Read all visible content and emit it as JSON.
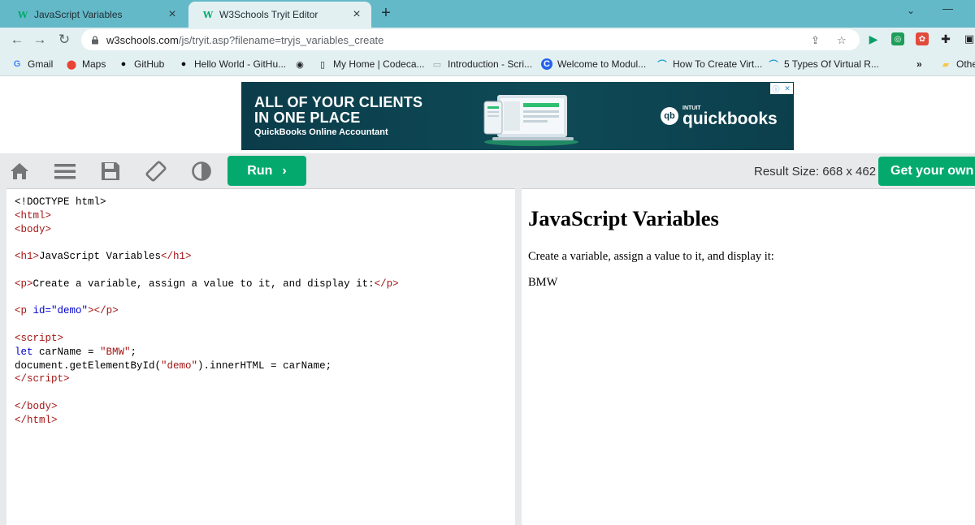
{
  "browser": {
    "tabs": [
      {
        "title": "JavaScript Variables",
        "active": false
      },
      {
        "title": "W3Schools Tryit Editor",
        "active": true
      }
    ],
    "url_host": "w3schools.com",
    "url_path": "/js/tryit.asp?filename=tryjs_variables_create",
    "bookmarks": [
      {
        "label": "Gmail",
        "icon": "google-icon"
      },
      {
        "label": "Maps",
        "icon": "maps-pin-icon"
      },
      {
        "label": "GitHub",
        "icon": "github-icon"
      },
      {
        "label": "Hello World - GitHu...",
        "icon": "github-icon"
      },
      {
        "label": "",
        "icon": "globe-icon"
      },
      {
        "label": "My Home | Codeca...",
        "icon": "codecademy-icon"
      },
      {
        "label": "Introduction - Scri...",
        "icon": "page-icon"
      },
      {
        "label": "Welcome to Modul...",
        "icon": "c-icon"
      },
      {
        "label": "How To Create Virt...",
        "icon": "bird-icon"
      },
      {
        "label": "5 Types Of Virtual R...",
        "icon": "bird-icon"
      }
    ],
    "bookmarks_overflow": "»",
    "other_bookmarks": "Othe"
  },
  "ad": {
    "line1": "ALL OF YOUR CLIENTS",
    "line2": "IN ONE PLACE",
    "sub": "QuickBooks Online Accountant",
    "brand_small": "INTUIT",
    "brand": "quickbooks",
    "brand_logo": "qb"
  },
  "tryit": {
    "run_label": "Run",
    "run_chevron": "›",
    "result_size": "Result Size: 668 x 462",
    "get_own": "Get your own w"
  },
  "result": {
    "heading": "JavaScript Variables",
    "paragraph": "Create a variable, assign a value to it, and display it:",
    "demo_output": "BMW"
  },
  "colors": {
    "tabstrip": "#64b9c8",
    "chrome": "#e3f0f2",
    "accent_green": "#04aa6d",
    "code_tag": "#a31515",
    "code_attr": "#0000cd"
  }
}
